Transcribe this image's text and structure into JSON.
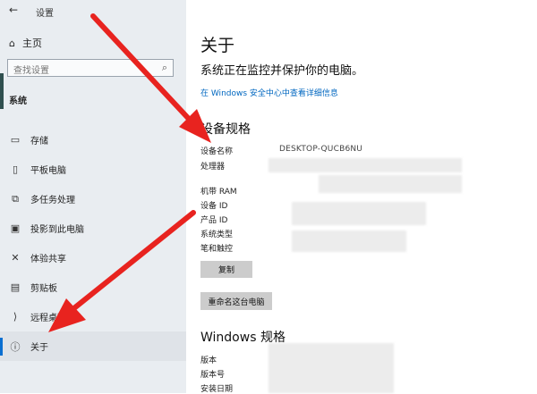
{
  "window": {
    "title": "设置",
    "back_glyph": "←"
  },
  "sidebar": {
    "home_label": "主页",
    "search_placeholder": "查找设置",
    "category": "系统",
    "items": [
      {
        "label": "存储",
        "icon": "storage-icon",
        "glyph": "▭"
      },
      {
        "label": "平板电脑",
        "icon": "tablet-icon",
        "glyph": "▯"
      },
      {
        "label": "多任务处理",
        "icon": "multitasking-icon",
        "glyph": "⧉"
      },
      {
        "label": "投影到此电脑",
        "icon": "project-icon",
        "glyph": "▣"
      },
      {
        "label": "体验共享",
        "icon": "share-icon",
        "glyph": "✕"
      },
      {
        "label": "剪贴板",
        "icon": "clipboard-icon",
        "glyph": "▤"
      },
      {
        "label": "远程桌面",
        "icon": "remote-icon",
        "glyph": "⟩"
      },
      {
        "label": "关于",
        "icon": "info-icon",
        "glyph": "ⓘ"
      }
    ]
  },
  "main": {
    "title": "关于",
    "subtitle": "系统正在监控并保护你的电脑。",
    "security_link": "在 Windows 安全中心中查看详细信息",
    "device_spec_heading": "设备规格",
    "device_specs": {
      "device_name_label": "设备名称",
      "device_name_value": "DESKTOP-QUCB6NU",
      "processor_label": "处理器",
      "ram_label": "机带 RAM",
      "device_id_label": "设备 ID",
      "product_id_label": "产品 ID",
      "system_type_label": "系统类型",
      "pen_touch_label": "笔和触控"
    },
    "copy_button": "复制",
    "rename_button": "重命名这台电脑",
    "windows_spec_heading": "Windows 规格",
    "windows_specs": {
      "edition_label": "版本",
      "version_label": "版本号",
      "install_date_label": "安装日期"
    }
  },
  "colors": {
    "arrow": "#e8231f",
    "link": "#0067c0",
    "sidebar_bg": "#e9edf1"
  }
}
